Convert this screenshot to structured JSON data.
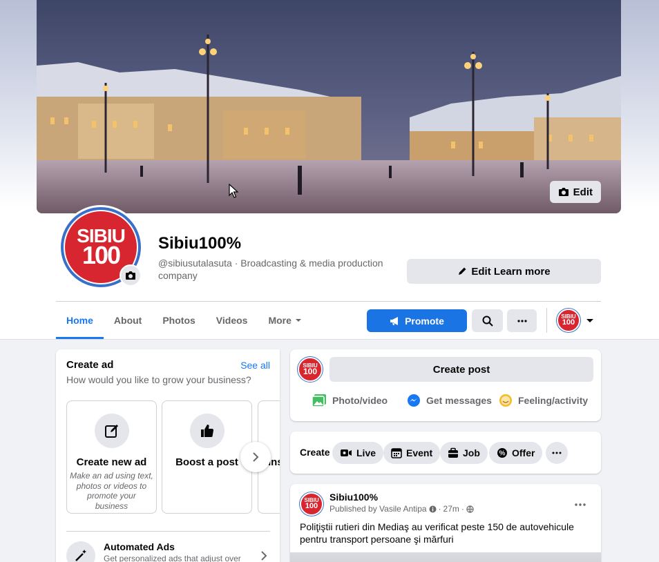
{
  "cover": {
    "edit_label": "Edit"
  },
  "page": {
    "name": "Sibiu100%",
    "username": "@sibiusutalasuta",
    "category": "Broadcasting & media production company",
    "logo_text_top": "SIBIU",
    "logo_text_bottom": "100",
    "edit_learn_label": "Edit Learn more"
  },
  "tabs": [
    {
      "label": "Home",
      "active": true
    },
    {
      "label": "About"
    },
    {
      "label": "Photos"
    },
    {
      "label": "Videos"
    },
    {
      "label": "More"
    }
  ],
  "actions": {
    "promote_label": "Promote"
  },
  "create_ad": {
    "title": "Create ad",
    "see_all": "See all",
    "subtitle": "How would you like to grow your business?",
    "tiles": [
      {
        "label": "Create new ad",
        "description": "Make an ad using text, photos or videos to promote your business",
        "icon": "edit-icon"
      },
      {
        "label": "Boost a post",
        "description": "",
        "icon": "thumbs-up-icon"
      },
      {
        "label": "Ins",
        "description": "",
        "icon": ""
      }
    ],
    "automated": {
      "title": "Automated Ads",
      "subtitle": "Get personalized ads that adjust over"
    }
  },
  "create_post": {
    "button_label": "Create post",
    "actions": [
      {
        "label": "Photo/video",
        "icon": "photo-icon",
        "color": "#45bd62"
      },
      {
        "label": "Get messages",
        "icon": "messenger-icon",
        "color": "#1877f2"
      },
      {
        "label": "Feeling/activity",
        "icon": "smiley-icon",
        "color": "#f7b928"
      }
    ]
  },
  "create_row": {
    "label": "Create",
    "chips": [
      {
        "label": "Live",
        "icon": "live-video-icon"
      },
      {
        "label": "Event",
        "icon": "calendar-icon"
      },
      {
        "label": "Job",
        "icon": "briefcase-icon"
      },
      {
        "label": "Offer",
        "icon": "offer-icon"
      }
    ]
  },
  "post": {
    "author": "Sibiu100%",
    "published_by": "Published by Vasile Antipa",
    "time": "27m",
    "text": "Poliţiştii rutieri din Mediaş au verificat peste 150 de autovehicule pentru transport persoane şi mărfuri"
  },
  "colors": {
    "accent": "#1877f2",
    "brand_red": "#d7262f"
  }
}
